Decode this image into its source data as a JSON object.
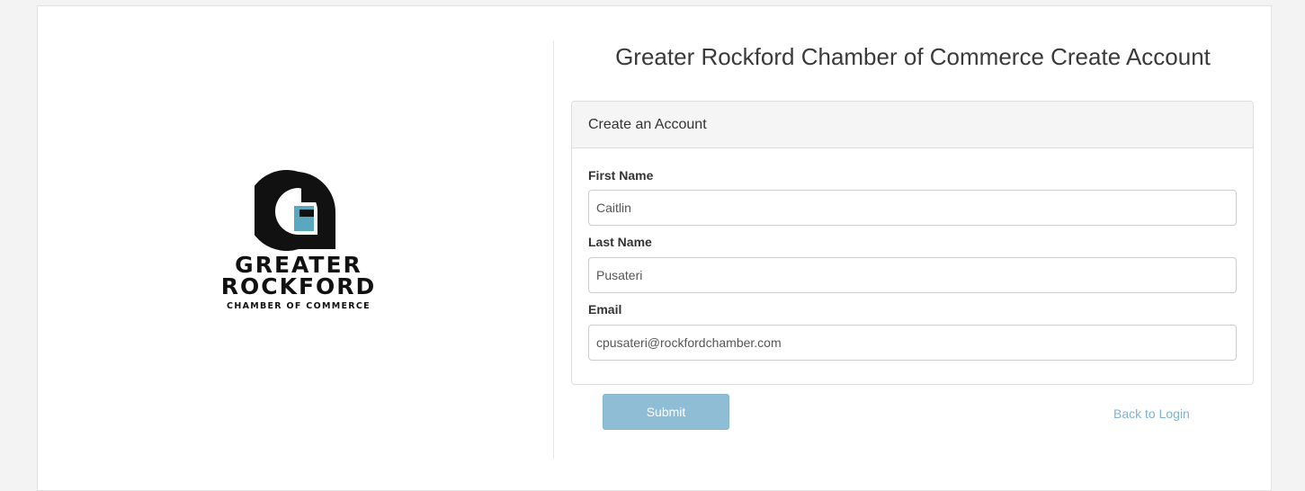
{
  "logo": {
    "line1": "GREATER",
    "line2": "ROCKFORD",
    "line3": "CHAMBER OF COMMERCE",
    "colors": {
      "dark": "#111111",
      "accent": "#5aa8c0"
    }
  },
  "page": {
    "title": "Greater Rockford Chamber of Commerce Create Account"
  },
  "panel": {
    "heading": "Create an Account",
    "fields": {
      "first_name": {
        "label": "First Name",
        "value": "Caitlin"
      },
      "last_name": {
        "label": "Last Name",
        "value": "Pusateri"
      },
      "email": {
        "label": "Email",
        "value": "cpusateri@rockfordchamber.com"
      }
    }
  },
  "actions": {
    "submit_label": "Submit",
    "back_label": "Back to Login"
  },
  "colors": {
    "submit_bg": "#8fbdd6",
    "link": "#7fb2d2",
    "background": "#f3f3f3"
  }
}
